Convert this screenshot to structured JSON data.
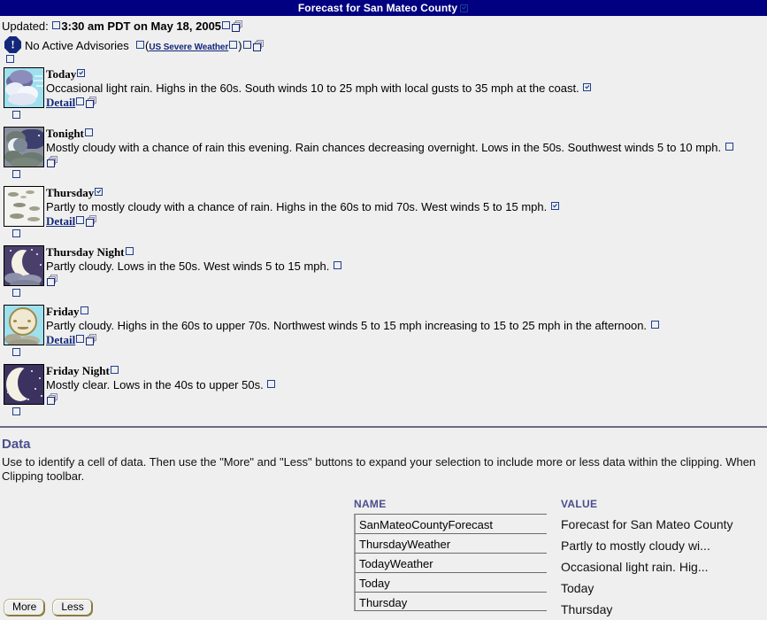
{
  "window": {
    "title": "Forecast for San Mateo County",
    "title_glyph": "box-checked"
  },
  "updated": {
    "label": "Updated:",
    "timestamp": "3:30 am PDT on May 18, 2005"
  },
  "advisory": {
    "icon": "warning-octagon-icon",
    "text": "No Active Advisories",
    "link_open_paren": "(",
    "link_text": "US Severe Weather",
    "link_close_paren": ")"
  },
  "forecasts": [
    {
      "day": "Today",
      "icon": "rain-clouds-icon",
      "description": "Occasional light rain. Highs in the 60s. South winds 10 to 25 mph with local gusts to 35 mph at the coast.",
      "end_glyph": "box-checked",
      "day_glyph": "box-checked",
      "detail_label": "Detail",
      "has_detail": true
    },
    {
      "day": "Tonight",
      "icon": "night-cloudy-icon",
      "description": "Mostly cloudy with a chance of rain this evening. Rain chances decreasing overnight. Lows in the 50s. Southwest winds 5 to 10 mph.",
      "end_glyph": "box-empty",
      "day_glyph": "box-empty",
      "detail_label": "",
      "has_detail": false
    },
    {
      "day": "Thursday",
      "icon": "partly-cloudy-icon",
      "description": "Partly to mostly cloudy with a chance of rain. Highs in the 60s to mid 70s. West winds 5 to 15 mph.",
      "end_glyph": "box-checked",
      "day_glyph": "box-checked",
      "detail_label": "Detail",
      "has_detail": true
    },
    {
      "day": "Thursday Night",
      "icon": "moon-clouds-icon",
      "description": "Partly cloudy. Lows in the 50s. West winds 5 to 15 mph.",
      "end_glyph": "box-empty",
      "day_glyph": "box-empty",
      "detail_label": "",
      "has_detail": false
    },
    {
      "day": "Friday",
      "icon": "sun-clouds-icon",
      "description": "Partly cloudy. Highs in the 60s to upper 70s. Northwest winds 5 to 15 mph increasing to 15 to 25 mph in the afternoon.",
      "end_glyph": "box-empty",
      "day_glyph": "box-empty",
      "detail_label": "Detail",
      "has_detail": true
    },
    {
      "day": "Friday Night",
      "icon": "moon-stars-icon",
      "description": "Mostly clear. Lows in the 40s to upper 50s.",
      "end_glyph": "box-empty",
      "day_glyph": "box-empty",
      "detail_label": "",
      "has_detail": false
    }
  ],
  "data_section": {
    "title": "Data",
    "description": "Use to identify a cell of data. Then use the \"More\" and \"Less\" buttons to expand your selection to include more or less data within the clipping. When\nClipping toolbar.",
    "columns": {
      "name": "NAME",
      "value": "VALUE"
    },
    "rows": [
      {
        "name": "SanMateoCountyForecast",
        "value": "Forecast for San Mateo County"
      },
      {
        "name": "ThursdayWeather",
        "value": "Partly to mostly cloudy wi..."
      },
      {
        "name": "TodayWeather",
        "value": "Occasional light rain. Hig..."
      },
      {
        "name": "Today",
        "value": "Today"
      },
      {
        "name": "Thursday",
        "value": "Thursday"
      }
    ]
  },
  "buttons": {
    "more": "More",
    "less": "Less"
  },
  "colors": {
    "titlebar": "#000080",
    "background": "#efefef",
    "accent": "#4a4f8c",
    "link": "#13287a"
  }
}
